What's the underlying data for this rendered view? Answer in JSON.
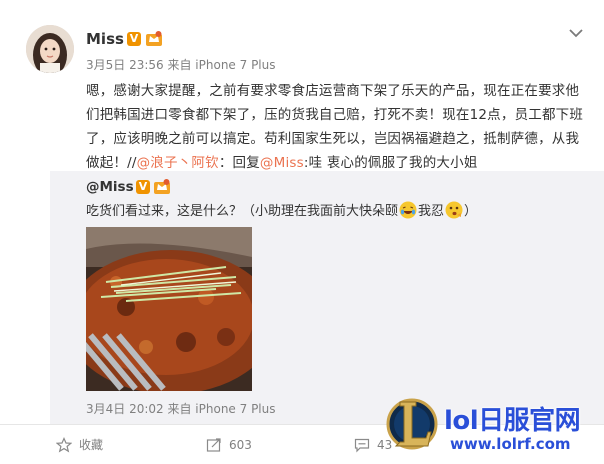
{
  "post": {
    "username": "Miss",
    "verified_badge": "V",
    "meta": "3月5日 23:56 来自 iPhone 7 Plus",
    "content_main": "嗯，感谢大家提醒，之前有要求零食店运营商下架了乐天的产品，现在正在要求他们把韩国进口零食都下架了，压的货我自己赔，打死不卖！现在12点，员工都下班了，应该明晚之前可以搞定。苟利国家生死以，岂因祸福避趋之，抵制萨德，从我做起！//",
    "mention_1": "@浪子丶阿钦",
    "reply_prefix": "：回复",
    "mention_2": "@Miss",
    "content_tail": ":哇 衷心的佩服了我的大小姐"
  },
  "repost": {
    "username": "@Miss",
    "verified_badge": "V",
    "text_before": "吃货们看过来，这是什么？（小助理在我面前大快朵颐",
    "text_mid": "我忍",
    "text_after": "）",
    "meta": "3月4日 20:02 来自 iPhone 7 Plus"
  },
  "actions": {
    "favorite_label": "收藏",
    "repost_count": "603",
    "comment_count": "43"
  },
  "watermark": {
    "title": "lol日服官网",
    "url": "www.lolrf.com"
  },
  "colors": {
    "link": "#eb7350",
    "verified": "#f09300",
    "meta_gray": "#808080",
    "repost_bg": "#f2f2f5",
    "watermark_blue": "#2a4fd8"
  },
  "icons": {
    "avatar": "avatar",
    "verified": "verified-v-icon",
    "member": "member-crown-icon",
    "menu": "chevron-down-icon",
    "favorite": "star-icon",
    "repost": "repost-icon",
    "comment": "comment-icon",
    "emoji_laugh": "laughing-emoji-icon",
    "emoji_think": "thinking-emoji-icon"
  }
}
